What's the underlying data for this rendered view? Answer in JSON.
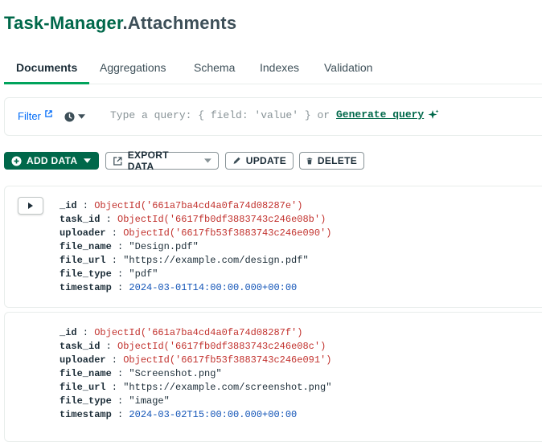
{
  "header": {
    "db_name": "Task-Manager",
    "collection_name": ".Attachments"
  },
  "tabs": [
    {
      "label": "Documents",
      "active": true
    },
    {
      "label": "Aggregations"
    },
    {
      "label": "Schema"
    },
    {
      "label": "Indexes"
    },
    {
      "label": "Validation"
    }
  ],
  "querybar": {
    "filter_label": "Filter",
    "placeholder": "Type a query: { field: 'value' } or",
    "generate_label": "Generate query"
  },
  "toolbar": {
    "add_data_label": "ADD DATA",
    "export_data_label": "EXPORT DATA",
    "update_label": "UPDATE",
    "delete_label": "DELETE"
  },
  "documents": [
    {
      "fields": [
        {
          "key": "_id",
          "value": "ObjectId('661a7ba4cd4a0fa74d08287e')",
          "type": "oid"
        },
        {
          "key": "task_id",
          "value": "ObjectId('6617fb0df3883743c246e08b')",
          "type": "oid"
        },
        {
          "key": "uploader",
          "value": "ObjectId('6617fb53f3883743c246e090')",
          "type": "oid"
        },
        {
          "key": "file_name",
          "value": "\"Design.pdf\"",
          "type": "str"
        },
        {
          "key": "file_url",
          "value": "\"https://example.com/design.pdf\"",
          "type": "str"
        },
        {
          "key": "file_type",
          "value": "\"pdf\"",
          "type": "str"
        },
        {
          "key": "timestamp",
          "value": "2024-03-01T14:00:00.000+00:00",
          "type": "date"
        }
      ]
    },
    {
      "fields": [
        {
          "key": "_id",
          "value": "ObjectId('661a7ba4cd4a0fa74d08287f')",
          "type": "oid"
        },
        {
          "key": "task_id",
          "value": "ObjectId('6617fb0df3883743c246e08c')",
          "type": "oid"
        },
        {
          "key": "uploader",
          "value": "ObjectId('6617fb53f3883743c246e091')",
          "type": "oid"
        },
        {
          "key": "file_name",
          "value": "\"Screenshot.png\"",
          "type": "str"
        },
        {
          "key": "file_url",
          "value": "\"https://example.com/screenshot.png\"",
          "type": "str"
        },
        {
          "key": "file_type",
          "value": "\"image\"",
          "type": "str"
        },
        {
          "key": "timestamp",
          "value": "2024-03-02T15:00:00.000+00:00",
          "type": "date"
        }
      ]
    }
  ],
  "icons": {
    "external_link": "external-link-icon",
    "clock": "clock-icon",
    "caret": "caret-down-icon",
    "sparkle": "sparkle-icon",
    "plus": "plus-circle-icon",
    "export": "export-icon",
    "pencil": "pencil-icon",
    "trash": "trash-icon",
    "expand": "expand-arrow-icon"
  },
  "colors": {
    "brand": "#00684a",
    "accent": "#00a35c",
    "link": "#016bf8",
    "objectid": "#c2322e",
    "date": "#1254b7"
  }
}
